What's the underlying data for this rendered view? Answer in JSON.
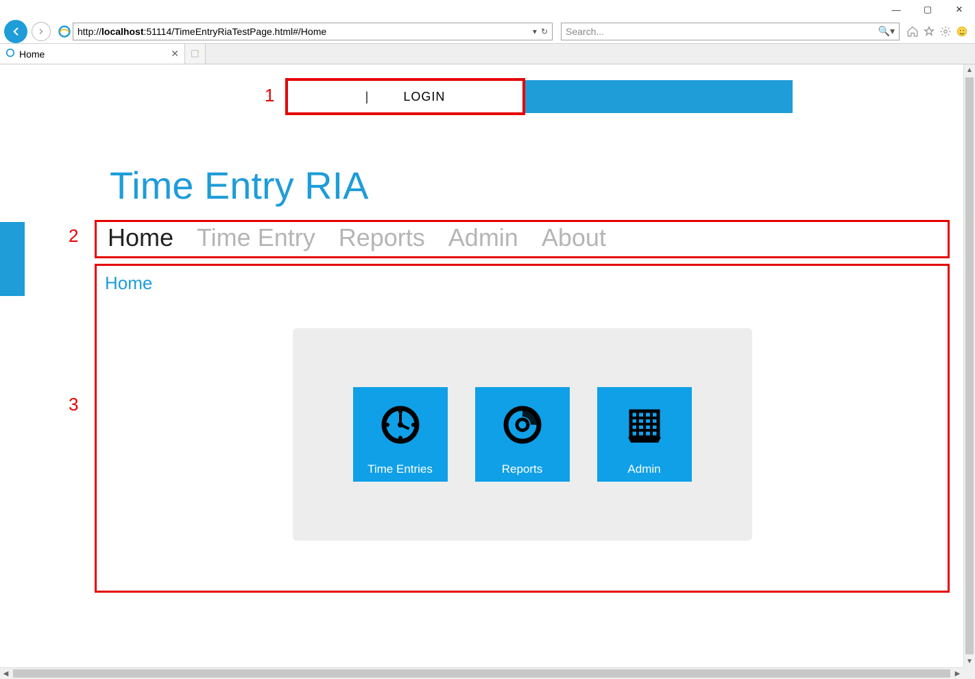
{
  "window": {
    "minimize": "—",
    "maximize": "▢",
    "close": "✕"
  },
  "browser": {
    "url_prefix": "http://",
    "url_host": "localhost",
    "url_rest": ":51114/TimeEntryRiaTestPage.html#/Home",
    "search_placeholder": "Search...",
    "tab_title": "Home"
  },
  "annotations": {
    "one": "1",
    "two": "2",
    "three": "3"
  },
  "login": {
    "label": "LOGIN",
    "separator": "|"
  },
  "app": {
    "title": "Time Entry RIA"
  },
  "nav": {
    "items": [
      {
        "label": "Home",
        "active": true
      },
      {
        "label": "Time Entry",
        "active": false
      },
      {
        "label": "Reports",
        "active": false
      },
      {
        "label": "Admin",
        "active": false
      },
      {
        "label": "About",
        "active": false
      }
    ]
  },
  "content": {
    "heading": "Home",
    "tiles": [
      {
        "label": "Time Entries",
        "icon": "clock"
      },
      {
        "label": "Reports",
        "icon": "disc"
      },
      {
        "label": "Admin",
        "icon": "calendar"
      }
    ]
  }
}
